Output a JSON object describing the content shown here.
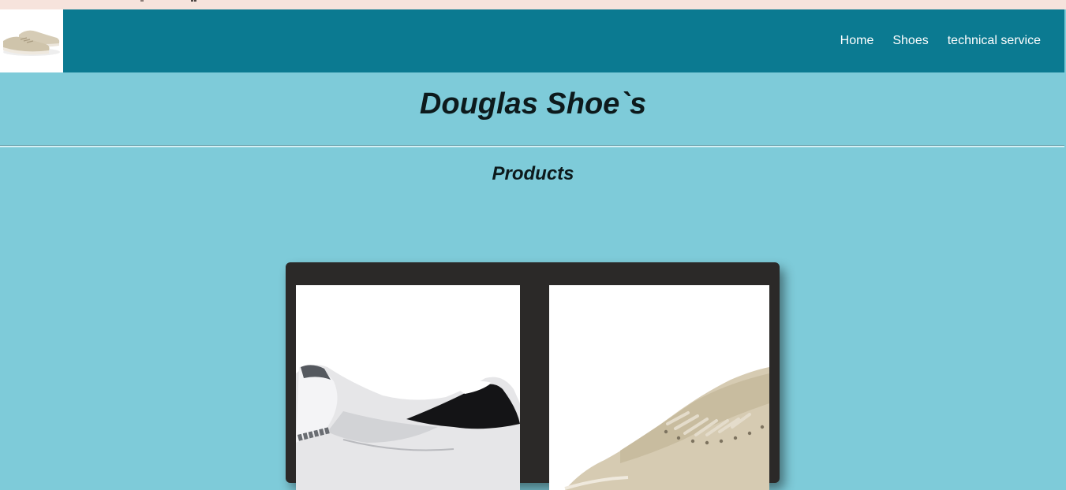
{
  "nav": {
    "items": [
      {
        "label": "Home"
      },
      {
        "label": "Shoes"
      },
      {
        "label": "technical service"
      }
    ]
  },
  "header": {
    "title": "Douglas Shoe`s"
  },
  "products": {
    "heading": "Products",
    "items": [
      {
        "image": "white-sneaker-photo"
      },
      {
        "image": "beige-sneaker-photo"
      }
    ]
  },
  "colors": {
    "navbar": "#0b7a91",
    "page_background": "#7ecbd9",
    "gallery_background": "#2b2928",
    "top_strip": "#f6e3dc"
  }
}
